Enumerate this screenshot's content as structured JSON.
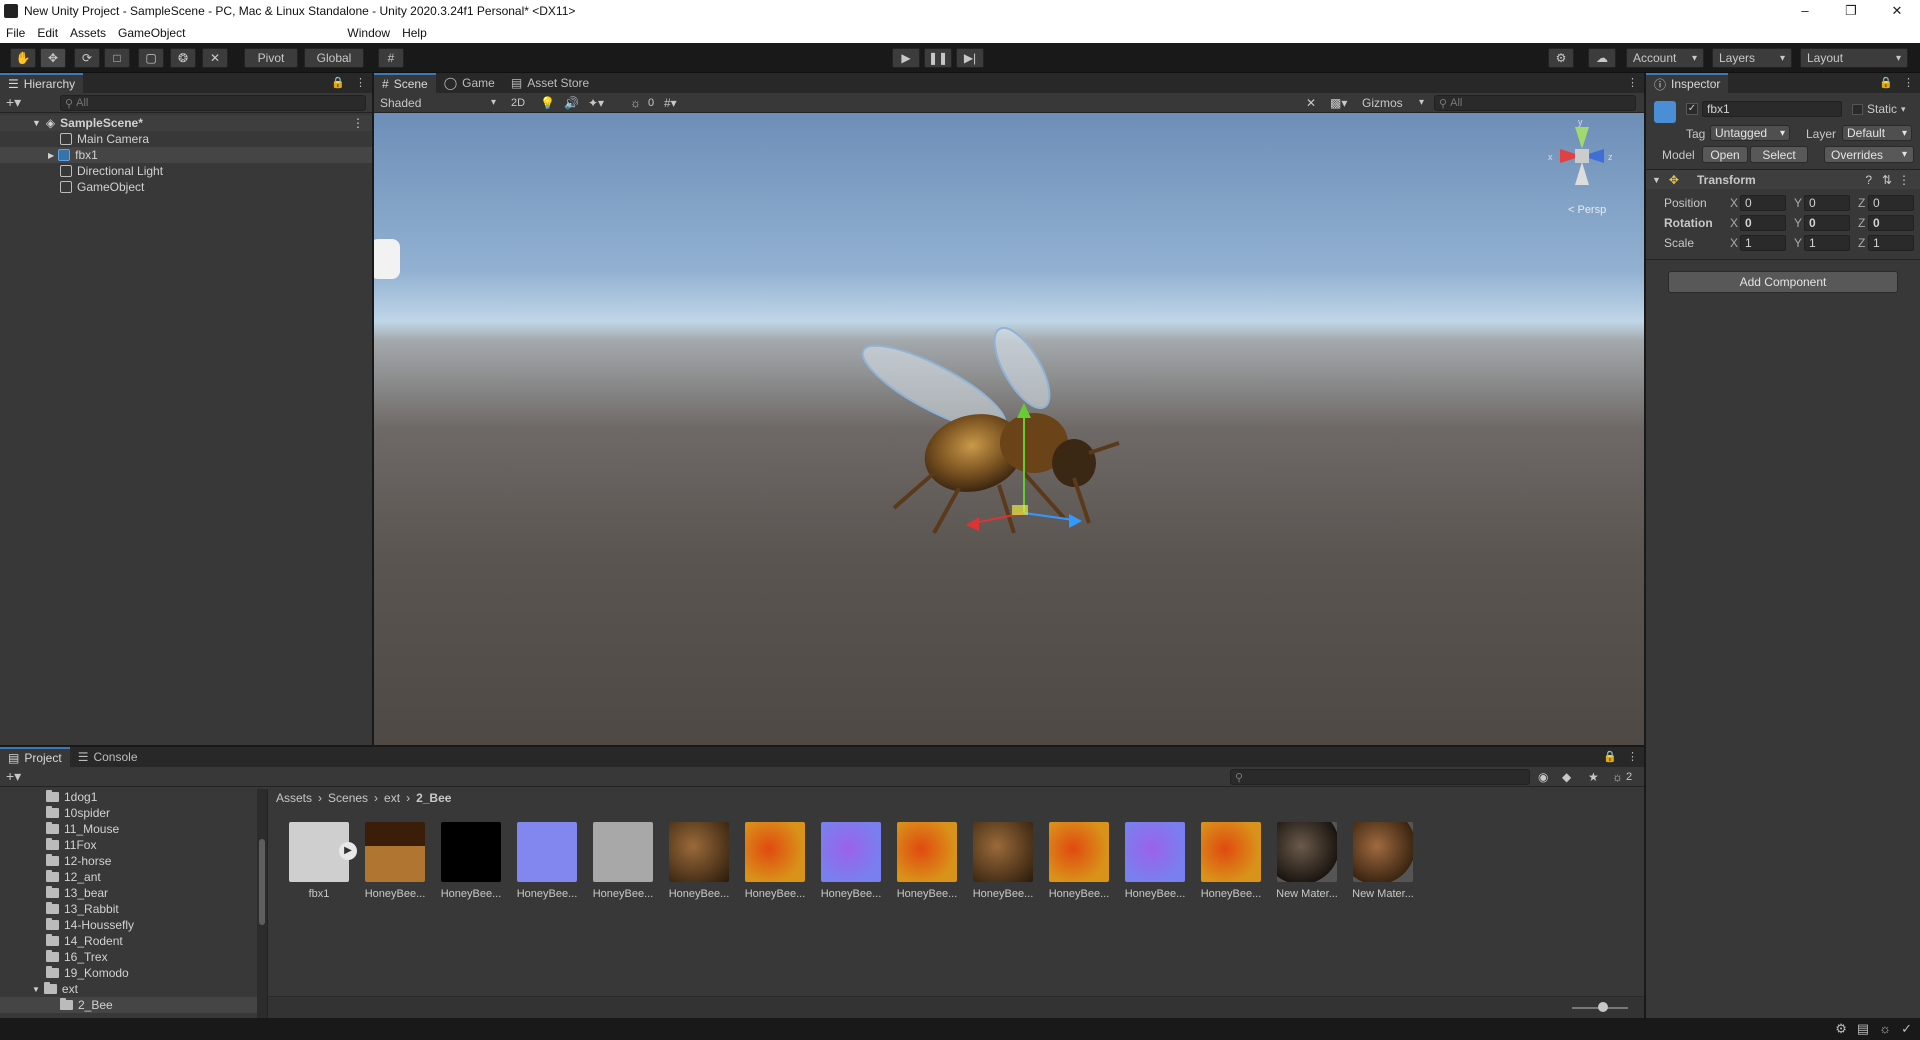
{
  "window": {
    "title": "New Unity Project - SampleScene - PC, Mac & Linux Standalone - Unity 2020.3.24f1 Personal* <DX11>"
  },
  "menu": [
    "File",
    "Edit",
    "Assets",
    "GameObject",
    "Window",
    "Help"
  ],
  "toolbar": {
    "pivot": "Pivot",
    "global": "Global",
    "account": "Account",
    "layers": "Layers",
    "layout": "Layout"
  },
  "hierarchy": {
    "tab": "Hierarchy",
    "search_placeholder": "All",
    "scene": "SampleScene*",
    "items": [
      "Main Camera",
      "fbx1",
      "Directional Light",
      "GameObject"
    ]
  },
  "scene_tabs": [
    "Scene",
    "Game",
    "Asset Store"
  ],
  "scene_toolbar": {
    "shading": "Shaded",
    "mode2d": "2D",
    "hidden_count": "0",
    "gizmos": "Gizmos",
    "search_placeholder": "All",
    "persp": "< Persp"
  },
  "inspector": {
    "tab": "Inspector",
    "object_name": "fbx1",
    "static": "Static",
    "tag_label": "Tag",
    "tag_value": "Untagged",
    "layer_label": "Layer",
    "layer_value": "Default",
    "model_label": "Model",
    "open": "Open",
    "select": "Select",
    "overrides": "Overrides",
    "transform": "Transform",
    "rows": [
      {
        "label": "Position",
        "x": "0",
        "y": "0",
        "z": "0"
      },
      {
        "label": "Rotation",
        "x": "0",
        "y": "0",
        "z": "0"
      },
      {
        "label": "Scale",
        "x": "1",
        "y": "1",
        "z": "1"
      }
    ],
    "axis": {
      "x": "X",
      "y": "Y",
      "z": "Z"
    },
    "add_component": "Add Component"
  },
  "project": {
    "tabs": [
      "Project",
      "Console"
    ],
    "hidden_count": "2",
    "folders": [
      "1dog1",
      "10spider",
      "11_Mouse",
      "11Fox",
      "12-horse",
      "12_ant",
      "13_bear",
      "13_Rabbit",
      "14-Houssefly",
      "14_Rodent",
      "16_Trex",
      "19_Komodo",
      "ext",
      "2_Bee"
    ],
    "breadcrumb": [
      "Assets",
      "Scenes",
      "ext",
      "2_Bee"
    ],
    "assets": [
      "fbx1",
      "HoneyBee...",
      "HoneyBee...",
      "HoneyBee...",
      "HoneyBee...",
      "HoneyBee...",
      "HoneyBee...",
      "HoneyBee...",
      "HoneyBee...",
      "HoneyBee...",
      "HoneyBee...",
      "HoneyBee...",
      "HoneyBee...",
      "New Mater...",
      "New Mater..."
    ]
  }
}
